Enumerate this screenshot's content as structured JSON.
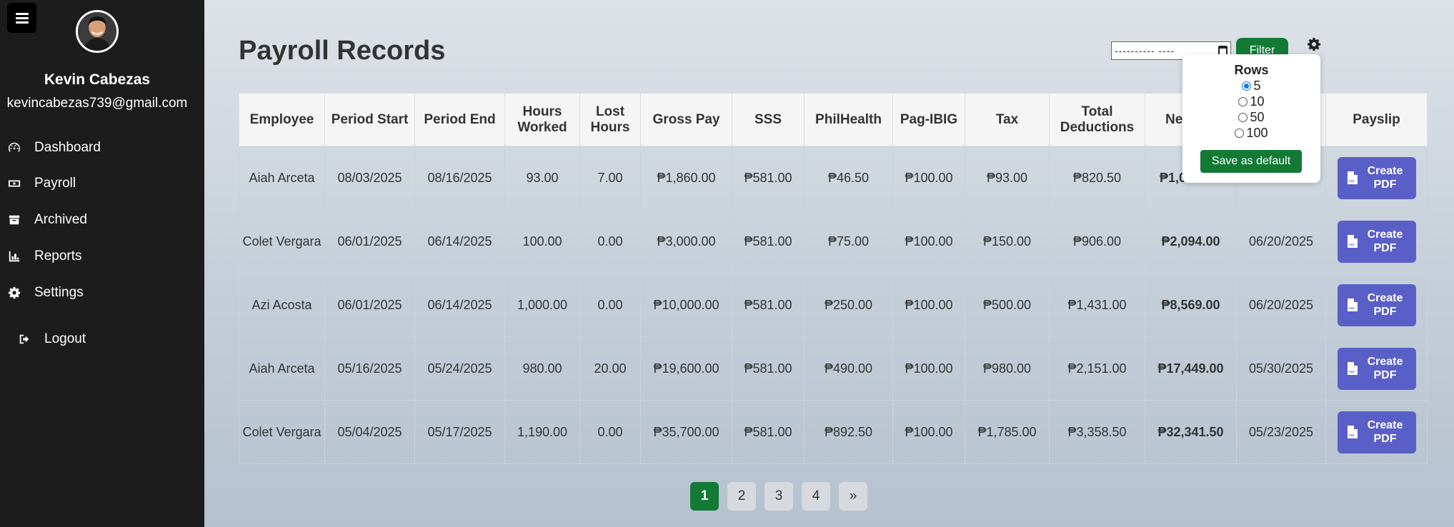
{
  "sidebar": {
    "user": {
      "name": "Kevin Cabezas",
      "email": "kevincabezas739@gmail.com"
    },
    "items": [
      {
        "label": "Dashboard",
        "icon": "gauge-icon"
      },
      {
        "label": "Payroll",
        "icon": "money-bill-icon"
      },
      {
        "label": "Archived",
        "icon": "archive-icon"
      },
      {
        "label": "Reports",
        "icon": "chart-icon"
      },
      {
        "label": "Settings",
        "icon": "gear-icon"
      },
      {
        "label": "Logout",
        "icon": "logout-icon"
      }
    ]
  },
  "header": {
    "title": "Payroll Records",
    "date_value": "---------- ----",
    "filter_label": "Filter"
  },
  "rows_popup": {
    "title": "Rows",
    "options": [
      "5",
      "10",
      "50",
      "100"
    ],
    "selected": "5",
    "save_label": "Save as default"
  },
  "table": {
    "headers": [
      "Employee",
      "Period Start",
      "Period End",
      "Hours Worked",
      "Lost Hours",
      "Gross Pay",
      "SSS",
      "PhilHealth",
      "Pag-IBIG",
      "Tax",
      "Total Deductions",
      "Ne",
      "",
      "Payslip"
    ],
    "rows": [
      {
        "employee": "Aiah Arceta",
        "period_start": "08/03/2025",
        "period_end": "08/16/2025",
        "hours_worked": "93.00",
        "lost_hours": "7.00",
        "gross_pay": "₱1,860.00",
        "sss": "₱581.00",
        "philhealth": "₱46.50",
        "pagibig": "₱100.00",
        "tax": "₱93.00",
        "total_deductions": "₱820.50",
        "net_pay": "₱1,0",
        "pay_date": "",
        "action": "Create PDF"
      },
      {
        "employee": "Colet Vergara",
        "period_start": "06/01/2025",
        "period_end": "06/14/2025",
        "hours_worked": "100.00",
        "lost_hours": "0.00",
        "gross_pay": "₱3,000.00",
        "sss": "₱581.00",
        "philhealth": "₱75.00",
        "pagibig": "₱100.00",
        "tax": "₱150.00",
        "total_deductions": "₱906.00",
        "net_pay": "₱2,094.00",
        "pay_date": "06/20/2025",
        "action": "Create PDF"
      },
      {
        "employee": "Azi Acosta",
        "period_start": "06/01/2025",
        "period_end": "06/14/2025",
        "hours_worked": "1,000.00",
        "lost_hours": "0.00",
        "gross_pay": "₱10,000.00",
        "sss": "₱581.00",
        "philhealth": "₱250.00",
        "pagibig": "₱100.00",
        "tax": "₱500.00",
        "total_deductions": "₱1,431.00",
        "net_pay": "₱8,569.00",
        "pay_date": "06/20/2025",
        "action": "Create PDF"
      },
      {
        "employee": "Aiah Arceta",
        "period_start": "05/16/2025",
        "period_end": "05/24/2025",
        "hours_worked": "980.00",
        "lost_hours": "20.00",
        "gross_pay": "₱19,600.00",
        "sss": "₱581.00",
        "philhealth": "₱490.00",
        "pagibig": "₱100.00",
        "tax": "₱980.00",
        "total_deductions": "₱2,151.00",
        "net_pay": "₱17,449.00",
        "pay_date": "05/30/2025",
        "action": "Create PDF"
      },
      {
        "employee": "Colet Vergara",
        "period_start": "05/04/2025",
        "period_end": "05/17/2025",
        "hours_worked": "1,190.00",
        "lost_hours": "0.00",
        "gross_pay": "₱35,700.00",
        "sss": "₱581.00",
        "philhealth": "₱892.50",
        "pagibig": "₱100.00",
        "tax": "₱1,785.00",
        "total_deductions": "₱3,358.50",
        "net_pay": "₱32,341.50",
        "pay_date": "05/23/2025",
        "action": "Create PDF"
      }
    ]
  },
  "pagination": {
    "pages": [
      "1",
      "2",
      "3",
      "4",
      "»"
    ],
    "active": "1"
  },
  "colors": {
    "sidebar_bg": "#1c1c1c",
    "accent_green": "#137a35",
    "pdf_button": "#5a5fc8"
  }
}
